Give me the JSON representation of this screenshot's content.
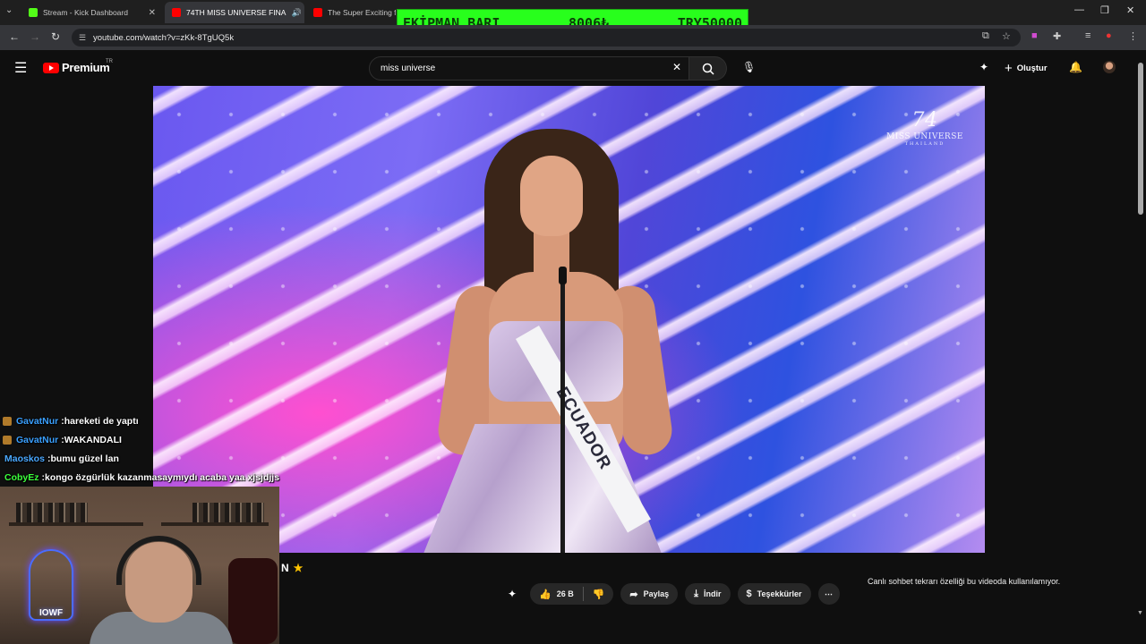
{
  "browser": {
    "tabs": [
      {
        "title": "Stream - Kick Dashboard",
        "favicon_color": "#53fc18"
      },
      {
        "title": "74TH MISS UNIVERSE FINA",
        "favicon_color": "#ff0000",
        "active": true
      },
      {
        "title": "The Super Exciting fina",
        "favicon_color": "#ff0000"
      }
    ],
    "url": "youtube.com/watch?v=zKk-8TgUQ5k"
  },
  "overlay": {
    "label": "EKİPMAN BARI",
    "amount": "8006₺",
    "goal": "TRY50000",
    "background": "#28ff1c"
  },
  "youtube": {
    "brand": "Premium",
    "region": "TR",
    "search_value": "miss universe",
    "create_label": "Oluştur"
  },
  "video": {
    "watermark_number": "74",
    "watermark_text": "MISS UNIVERSE",
    "watermark_sub": "THAILAND",
    "sash_text": "ECUADOR"
  },
  "actions": {
    "likes": "26 B",
    "share": "Paylaş",
    "download": "İndir",
    "thanks": "Teşekkürler"
  },
  "live_chat_notice": "Canlı sohbet tekrarı özelliği bu videoda kullanılamıyor.",
  "title_fragment": "N",
  "chat": [
    {
      "user": "GavatNur",
      "user_color": "#3aa0ff",
      "badge": true,
      "text": "hareketi de yaptı"
    },
    {
      "user": "GavatNur",
      "user_color": "#3aa0ff",
      "badge": true,
      "text": "WAKANDALI"
    },
    {
      "user": "Maoskos",
      "user_color": "#4aa8ff",
      "badge": false,
      "text": "bumu güzel lan"
    },
    {
      "user": "CobyEz",
      "user_color": "#3cff3c",
      "badge": false,
      "text": "kongo özgürlük kazanmasaymıydı acaba yaa xjsjdjjs"
    }
  ],
  "webcam": {
    "neon_text": "IOWF"
  }
}
